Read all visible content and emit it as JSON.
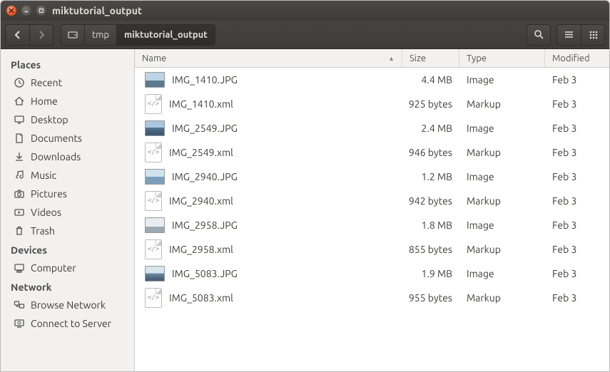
{
  "window": {
    "title": "miktutorial_output"
  },
  "path": {
    "seg1": "tmp",
    "seg2": "miktutorial_output"
  },
  "sidebar": {
    "places_heading": "Places",
    "places": [
      {
        "label": "Recent",
        "icon": "clock"
      },
      {
        "label": "Home",
        "icon": "home"
      },
      {
        "label": "Desktop",
        "icon": "desktop"
      },
      {
        "label": "Documents",
        "icon": "doc"
      },
      {
        "label": "Downloads",
        "icon": "download"
      },
      {
        "label": "Music",
        "icon": "music"
      },
      {
        "label": "Pictures",
        "icon": "camera"
      },
      {
        "label": "Videos",
        "icon": "video"
      },
      {
        "label": "Trash",
        "icon": "trash"
      }
    ],
    "devices_heading": "Devices",
    "devices": [
      {
        "label": "Computer",
        "icon": "computer"
      }
    ],
    "network_heading": "Network",
    "network": [
      {
        "label": "Browse Network",
        "icon": "netbrowse"
      },
      {
        "label": "Connect to Server",
        "icon": "netconnect"
      }
    ]
  },
  "columns": {
    "name": "Name",
    "size": "Size",
    "type": "Type",
    "modified": "Modified",
    "sort_indicator": "▲"
  },
  "files": [
    {
      "name": "IMG_1410.JPG",
      "size": "4.4 MB",
      "type": "Image",
      "modified": "Feb 3",
      "kind": "jpg",
      "thumb_gradient": "linear-gradient(to bottom,#bcd5e6 55%,#5c7a90 55%)"
    },
    {
      "name": "IMG_1410.xml",
      "size": "925 bytes",
      "type": "Markup",
      "modified": "Feb 3",
      "kind": "xml"
    },
    {
      "name": "IMG_2549.JPG",
      "size": "2.4 MB",
      "type": "Image",
      "modified": "Feb 3",
      "kind": "jpg",
      "thumb_gradient": "linear-gradient(to bottom,#a8c6de 45%,#587896 45%,#3e5a72 80%)"
    },
    {
      "name": "IMG_2549.xml",
      "size": "946 bytes",
      "type": "Markup",
      "modified": "Feb 3",
      "kind": "xml"
    },
    {
      "name": "IMG_2940.JPG",
      "size": "1.2 MB",
      "type": "Image",
      "modified": "Feb 3",
      "kind": "jpg",
      "thumb_gradient": "linear-gradient(to bottom,#cfe2ef 50%,#7ba0bd 50%)"
    },
    {
      "name": "IMG_2940.xml",
      "size": "942 bytes",
      "type": "Markup",
      "modified": "Feb 3",
      "kind": "xml"
    },
    {
      "name": "IMG_2958.JPG",
      "size": "1.8 MB",
      "type": "Image",
      "modified": "Feb 3",
      "kind": "jpg",
      "thumb_gradient": "linear-gradient(to bottom,#e8edf1 60%,#9aa9b4 60%)"
    },
    {
      "name": "IMG_2958.xml",
      "size": "855 bytes",
      "type": "Markup",
      "modified": "Feb 3",
      "kind": "xml"
    },
    {
      "name": "IMG_5083.JPG",
      "size": "1.9 MB",
      "type": "Image",
      "modified": "Feb 3",
      "kind": "jpg",
      "thumb_gradient": "linear-gradient(to bottom,#d8e5ee 48%,#6f8ca3 48%,#4a6277 85%)"
    },
    {
      "name": "IMG_5083.xml",
      "size": "955 bytes",
      "type": "Markup",
      "modified": "Feb 3",
      "kind": "xml"
    }
  ]
}
